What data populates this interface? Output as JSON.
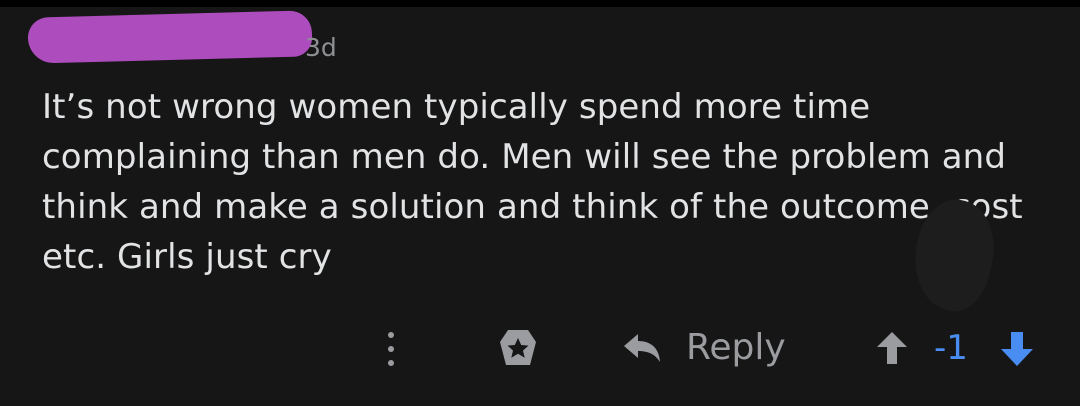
{
  "comment": {
    "timestamp": "3d",
    "body": "It’s not wrong women typically spend more time complaining than men do. Men will see the problem and think and make a solution and think of the outcome, cost etc. Girls just cry"
  },
  "actions": {
    "more_icon": "more-vertical-icon",
    "award_icon": "award-icon",
    "reply_icon": "reply-arrow-icon",
    "reply_label": "Reply",
    "upvote_icon": "upvote-arrow-icon",
    "score": "-1",
    "downvote_icon": "downvote-arrow-icon"
  },
  "colors": {
    "background": "#161616",
    "text": "#e1e3e5",
    "muted": "#9a9c9f",
    "vote_blue": "#4a8df2",
    "redaction": "#ad4cbd"
  }
}
